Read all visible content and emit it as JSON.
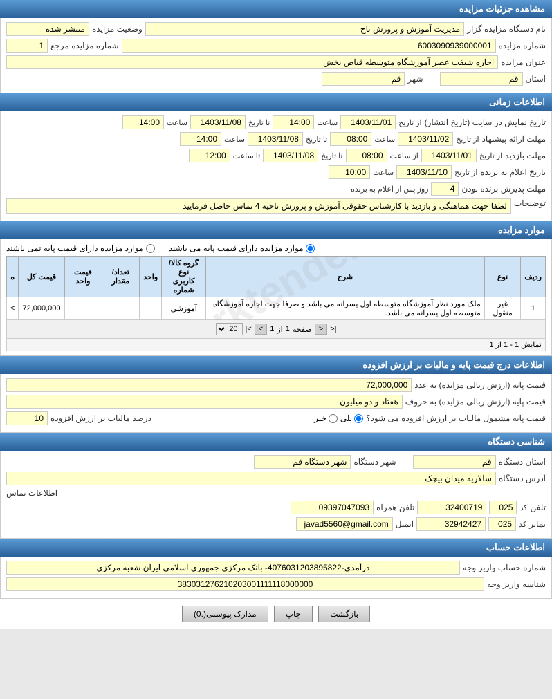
{
  "page": {
    "title": "مشاهده جزئیات مزایده",
    "sections": {
      "auction_details": {
        "header": "مشاهده جزئیات مزایده",
        "fields": {
          "organizer_label": "نام دستگاه مزایده گزار",
          "organizer_value": "مدیریت آموزش و پرورش ناح",
          "status_label": "وضعیت مزایده",
          "status_value": "منتشر شده",
          "auction_number_label": "شماره مزایده",
          "auction_number_value": "6003090939000001",
          "ref_number_label": "شماره مزایده مرجع",
          "ref_number_value": "1",
          "title_label": "عنوان مزایده",
          "title_value": "اجاره شیفت عصر آموزشگاه متوسطه قیاض بخش",
          "province_label": "استان",
          "province_value": "قم",
          "city_label": "شهر",
          "city_value": "قم"
        }
      },
      "time_info": {
        "header": "اطلاعات زمانی",
        "rows": [
          {
            "label": "تاریخ نمایش در سایت (تاریخ انتشار)",
            "from_date": "1403/11/01",
            "from_time": "14:00",
            "to_date": "1403/11/08",
            "to_time": "14:00"
          },
          {
            "label": "مهلت ارائه پیشنهاد",
            "from_date": "1403/11/02",
            "from_time": "08:00",
            "to_date": "1403/11/08",
            "to_time": "14:00"
          },
          {
            "label": "مهلت بازدید",
            "from_date": "1403/11/01",
            "from_time": "08:00",
            "to_date": "1403/11/08",
            "to_time": "12:00"
          },
          {
            "label": "تاریخ اعلام به برنده",
            "from_date": "1403/11/10",
            "from_time": "10:00"
          },
          {
            "label": "مهلت پذیرش برنده بودن",
            "days_value": "4",
            "days_unit": "روز پس از اعلام به برنده"
          }
        ],
        "notes_label": "توضیحات",
        "notes_value": "لطفا جهت هماهنگی و بازدید با کارشناس حقوقی آموزش و پرورش ناحیه 4 تماس حاصل فرمایید"
      },
      "auction_items": {
        "header": "موارد مزایده",
        "radio_options": {
          "has_base_price": "موارد مزایده دارای قیمت پایه می باشند",
          "no_base_price": "موارد مزایده دارای قیمت پایه نمی باشند"
        },
        "table": {
          "headers": [
            "ردیف",
            "نوع",
            "شرح",
            "گروه کالا/نوع کاربری شماره",
            "واحد",
            "تعداد/مقدار",
            "قیمت واحد",
            "قیمت کل",
            "ه"
          ],
          "rows": [
            {
              "row": "1",
              "type": "غیر منقول",
              "description": "ملک مورد نظر آموزشگاه متوسطه اول پسرانه می باشد و صرفا جهت اجاره آموزشگاه متوسطه اول پسرانه می باشد.",
              "category": "آموزشی",
              "unit": "",
              "quantity": "",
              "unit_price": "",
              "total_price": "72,000,000",
              "extra": ">"
            }
          ]
        },
        "pagination": {
          "per_page_label": "20",
          "page_label": "صفحه",
          "current_page": "1",
          "of_label": "از",
          "total_pages": "1",
          "show_label": "نمایش 1 - 1 از 1"
        }
      },
      "base_price_vat": {
        "header": "اطلاعات درج قیمت پایه و مالیات بر ارزش افزوده",
        "fields": {
          "base_price_num_label": "قیمت پایه (ارزش ریالی مزایده) به عدد",
          "base_price_num_value": "72,000,000",
          "base_price_text_label": "قیمت پایه (ارزش ریالی مزایده) به حروف",
          "base_price_text_value": "هفتاد و دو میلیون",
          "vat_question": "قیمت پایه مشمول مالیات بر ارزش افزوده می شود؟",
          "vat_yes": "بلی",
          "vat_no": "خیر",
          "vat_selected": "بلی",
          "vat_percent_label": "درصد مالیات بر ارزش افزوده",
          "vat_percent_value": "10"
        }
      },
      "device_info": {
        "header": "شناسی دستگاه",
        "fields": {
          "province_label": "استان دستگاه",
          "province_value": "قم",
          "city_label": "شهر دستگاه",
          "city_value": "شهر دستگاه قم",
          "address_label": "آدرس دستگاه",
          "address_value": "سالاریه میدان بیچک"
        },
        "contact_header": "اطلاعات تماس",
        "contact": {
          "phone_label": "تلفن",
          "phone_code": "025",
          "phone_number": "32400719",
          "fax_label": "نمابر",
          "fax_code": "025",
          "fax_number": "32942427",
          "mobile_label": "تلفن همراه",
          "mobile_value": "09397047093",
          "email_label": "ایمیل",
          "email_value": "javad5560@gmail.com"
        }
      },
      "account_info": {
        "header": "اطلاعات حساب",
        "fields": {
          "deposit_label": "شماره حساب واریز وجه",
          "deposit_value": "درآمدی-4076031203895822- بانک مرکزی جمهوری اسلامی ایران شعبه مرکزی",
          "sheba_label": "شناسه واریز وجه",
          "sheba_value": "383031276210203001111118000000"
        }
      },
      "buttons": {
        "attachments": "مدارک پیوستی(.0)",
        "print": "چاپ",
        "back": "بازگشت"
      }
    }
  }
}
